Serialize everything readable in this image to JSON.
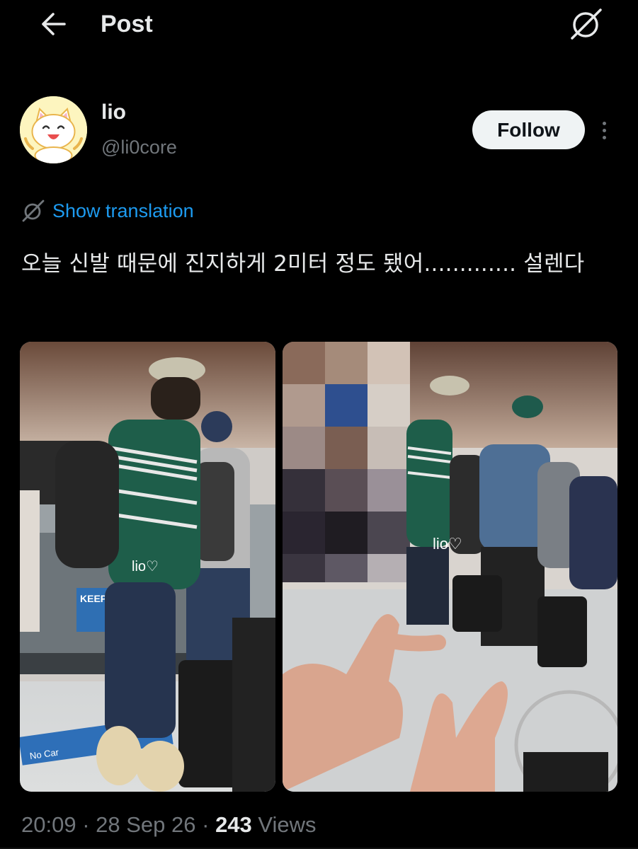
{
  "header": {
    "title": "Post",
    "back_icon": "arrow-left-icon",
    "grok_icon": "grok-icon"
  },
  "author": {
    "display_name": "lio",
    "handle": "@li0core",
    "avatar_icon": "cat-avatar"
  },
  "follow_label": "Follow",
  "more_icon": "more-vertical-icon",
  "translation": {
    "label": "Show translation",
    "icon": "translate-icon"
  },
  "tweet": {
    "text": "오늘 신발 때문에 진지하게 2미터 정도 됐어............. 설렌다"
  },
  "media": {
    "left_caption": "lio♡",
    "right_caption": "lio♡",
    "left_sign_text": "KEEP",
    "left_floor_text": "No Car"
  },
  "meta": {
    "time": "20:09",
    "sep1": " · ",
    "date": "28 Sep 26",
    "sep2": " · ",
    "views_count": "243",
    "views_label": " Views"
  },
  "colors": {
    "background": "#000000",
    "accent": "#1d9bf0",
    "text": "#e7e9ea",
    "secondary": "#71767b"
  }
}
